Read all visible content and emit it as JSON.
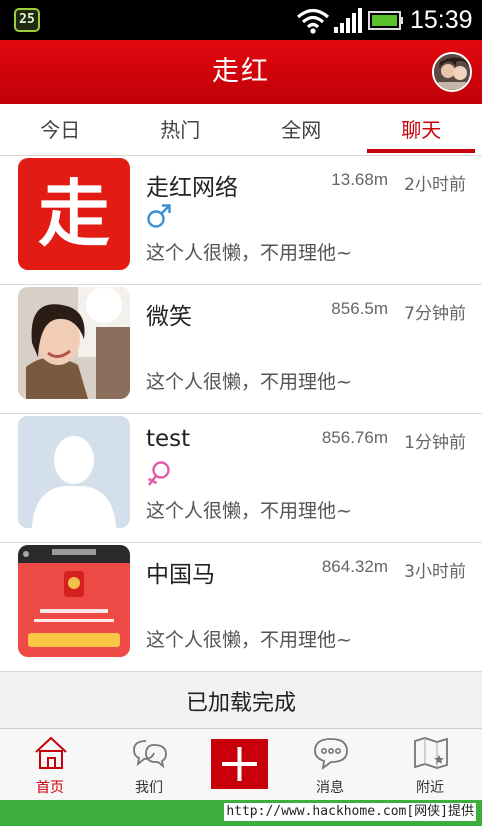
{
  "status_bar": {
    "notification_badge": "25",
    "time": "15:39"
  },
  "header": {
    "title": "走红"
  },
  "tabs": [
    {
      "label": "今日",
      "active": false
    },
    {
      "label": "热门",
      "active": false
    },
    {
      "label": "全网",
      "active": false
    },
    {
      "label": "聊天",
      "active": true
    }
  ],
  "chats": [
    {
      "name": "走红网络",
      "distance": "13.68m",
      "time_ago": "2小时前",
      "gender": "male",
      "signature": "这个人很懒，不用理他~",
      "avatar_char": "走"
    },
    {
      "name": "微笑",
      "distance": "856.5m",
      "time_ago": "7分钟前",
      "gender": "",
      "signature": "这个人很懒，不用理他~"
    },
    {
      "name": "test",
      "distance": "856.76m",
      "time_ago": "1分钟前",
      "gender": "female",
      "signature": "这个人很懒，不用理他~"
    },
    {
      "name": "中国马",
      "distance": "864.32m",
      "time_ago": "3小时前",
      "gender": "",
      "signature": "这个人很懒，不用理他~"
    }
  ],
  "loaded_text": "已加载完成",
  "bottom_nav": [
    {
      "label": "首页",
      "icon": "home-icon",
      "active": true
    },
    {
      "label": "我们",
      "icon": "chat-bubbles-icon",
      "active": false
    },
    {
      "label": "",
      "icon": "plus-icon",
      "active": false
    },
    {
      "label": "消息",
      "icon": "message-icon",
      "active": false
    },
    {
      "label": "附近",
      "icon": "map-flag-icon",
      "active": false
    }
  ],
  "footer": {
    "watermark": "http://www.hackhome.com[网侠]提供"
  },
  "colors": {
    "brand_red": "#c8000a",
    "male_blue": "#3a8fd3",
    "female_pink": "#e25ba6",
    "footer_green": "#3cae3c"
  }
}
